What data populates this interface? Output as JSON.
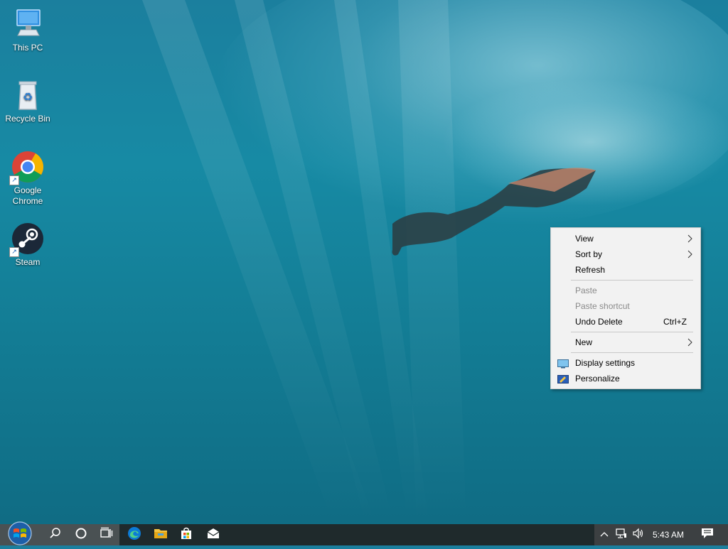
{
  "desktop": {
    "icons": [
      {
        "label": "This PC",
        "icon": "computer-icon"
      },
      {
        "label": "Recycle Bin",
        "icon": "recycle-bin-icon"
      },
      {
        "label": "Google Chrome",
        "icon": "chrome-icon"
      },
      {
        "label": "Steam",
        "icon": "steam-icon"
      }
    ]
  },
  "context_menu": {
    "view": "View",
    "sort_by": "Sort by",
    "refresh": "Refresh",
    "paste": "Paste",
    "paste_shortcut": "Paste shortcut",
    "undo_delete": "Undo Delete",
    "undo_delete_accel": "Ctrl+Z",
    "new": "New",
    "display_settings": "Display settings",
    "personalize": "Personalize"
  },
  "taskbar": {
    "start": "start-icon",
    "search": "search-icon",
    "cortana": "cortana-icon",
    "task_view": "task-view-icon",
    "pinned": [
      "edge-icon",
      "file-explorer-icon",
      "store-icon",
      "mail-icon"
    ],
    "tray": {
      "show_hidden": "chevron-up-icon",
      "network": "network-icon",
      "volume": "volume-icon",
      "clock": "5:43 AM",
      "notifications": "notification-icon"
    }
  },
  "colors": {
    "taskbar": "#1f2a2c",
    "menu_bg": "#f2f2f2",
    "accent": "#1a73e8"
  }
}
